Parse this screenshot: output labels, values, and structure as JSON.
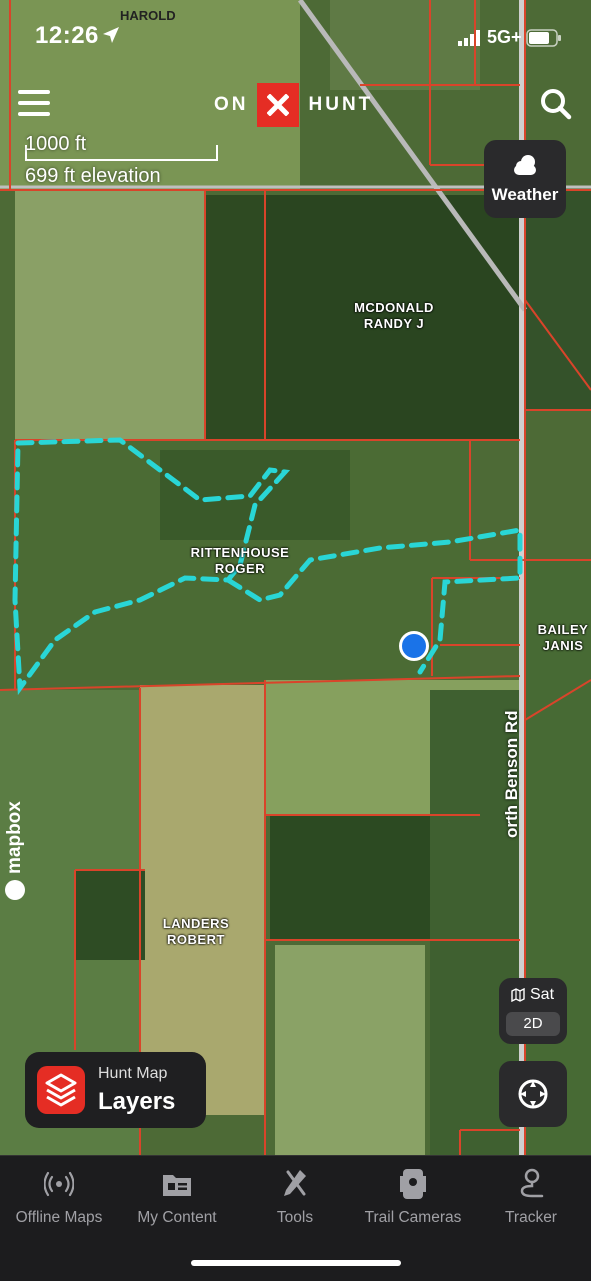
{
  "status_bar": {
    "time": "12:26",
    "network": "5G+"
  },
  "header": {
    "logo_left": "ON",
    "logo_right": "HUNT"
  },
  "scale": {
    "distance": "1000 ft",
    "elevation": "699 ft elevation"
  },
  "weather": {
    "label": "Weather"
  },
  "map": {
    "road_label": "orth Benson Rd",
    "top_label": "HAROLD",
    "attribution": "mapbox",
    "owners": [
      {
        "line1": "MCDONALD",
        "line2": "RANDY J"
      },
      {
        "line1": "RITTENHOUSE",
        "line2": "ROGER"
      },
      {
        "line1": "BAILEY",
        "line2": "JANIS"
      },
      {
        "line1": "LANDERS",
        "line2": "ROBERT"
      }
    ]
  },
  "map_style": {
    "mode": "Sat",
    "view": "2D"
  },
  "layers_button": {
    "subtitle": "Hunt Map",
    "title": "Layers"
  },
  "tabs": [
    {
      "label": "Offline Maps",
      "icon": "offline-maps-icon"
    },
    {
      "label": "My Content",
      "icon": "folder-icon"
    },
    {
      "label": "Tools",
      "icon": "tools-icon"
    },
    {
      "label": "Trail Cameras",
      "icon": "trail-camera-icon"
    },
    {
      "label": "Tracker",
      "icon": "tracker-icon"
    }
  ],
  "colors": {
    "brand_red": "#e52d24",
    "parcel_line": "#d9442a",
    "hunt_area": "#29d6d6",
    "location_dot": "#1a73e8"
  }
}
